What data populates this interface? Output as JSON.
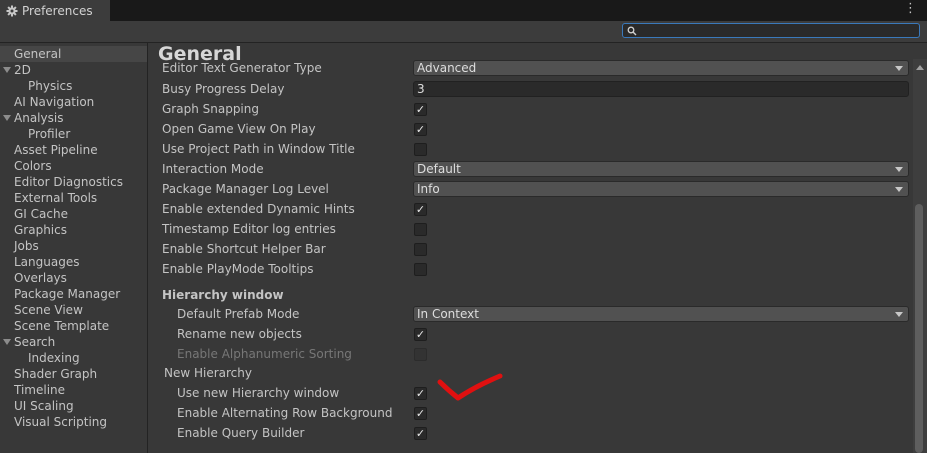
{
  "window": {
    "tab_label": "Preferences",
    "tab_icon": "gear-icon",
    "menu_icon": "kebab-menu-icon",
    "kebab_glyph": "⋮"
  },
  "search": {
    "placeholder": "",
    "value": ""
  },
  "sidebar": {
    "items": [
      {
        "label": "General",
        "selected": true,
        "expandable": false,
        "indent": 1
      },
      {
        "label": "2D",
        "selected": false,
        "expandable": true,
        "indent": 1
      },
      {
        "label": "Physics",
        "selected": false,
        "expandable": false,
        "indent": 2
      },
      {
        "label": "AI Navigation",
        "selected": false,
        "expandable": false,
        "indent": 1
      },
      {
        "label": "Analysis",
        "selected": false,
        "expandable": true,
        "indent": 1
      },
      {
        "label": "Profiler",
        "selected": false,
        "expandable": false,
        "indent": 2
      },
      {
        "label": "Asset Pipeline",
        "selected": false,
        "expandable": false,
        "indent": 1
      },
      {
        "label": "Colors",
        "selected": false,
        "expandable": false,
        "indent": 1
      },
      {
        "label": "Editor Diagnostics",
        "selected": false,
        "expandable": false,
        "indent": 1
      },
      {
        "label": "External Tools",
        "selected": false,
        "expandable": false,
        "indent": 1
      },
      {
        "label": "GI Cache",
        "selected": false,
        "expandable": false,
        "indent": 1
      },
      {
        "label": "Graphics",
        "selected": false,
        "expandable": false,
        "indent": 1
      },
      {
        "label": "Jobs",
        "selected": false,
        "expandable": false,
        "indent": 1
      },
      {
        "label": "Languages",
        "selected": false,
        "expandable": false,
        "indent": 1
      },
      {
        "label": "Overlays",
        "selected": false,
        "expandable": false,
        "indent": 1
      },
      {
        "label": "Package Manager",
        "selected": false,
        "expandable": false,
        "indent": 1
      },
      {
        "label": "Scene View",
        "selected": false,
        "expandable": false,
        "indent": 1
      },
      {
        "label": "Scene Template",
        "selected": false,
        "expandable": false,
        "indent": 1
      },
      {
        "label": "Search",
        "selected": false,
        "expandable": true,
        "indent": 1
      },
      {
        "label": "Indexing",
        "selected": false,
        "expandable": false,
        "indent": 2
      },
      {
        "label": "Shader Graph",
        "selected": false,
        "expandable": false,
        "indent": 1
      },
      {
        "label": "Timeline",
        "selected": false,
        "expandable": false,
        "indent": 1
      },
      {
        "label": "UI Scaling",
        "selected": false,
        "expandable": false,
        "indent": 1
      },
      {
        "label": "Visual Scripting",
        "selected": false,
        "expandable": false,
        "indent": 1
      }
    ]
  },
  "main": {
    "title": "General",
    "rows": [
      {
        "label": "Editor Text Generator Type",
        "control": "dropdown",
        "value": "Advanced",
        "indent": 0,
        "disabled": false,
        "clipped": true
      },
      {
        "label": "Busy Progress Delay",
        "control": "text",
        "value": "3",
        "indent": 0,
        "disabled": false
      },
      {
        "label": "Graph Snapping",
        "control": "checkbox",
        "checked": true,
        "indent": 0,
        "disabled": false
      },
      {
        "label": "Open Game View On Play",
        "control": "checkbox",
        "checked": true,
        "indent": 0,
        "disabled": false
      },
      {
        "label": "Use Project Path in Window Title",
        "control": "checkbox",
        "checked": false,
        "indent": 0,
        "disabled": false
      },
      {
        "label": "Interaction Mode",
        "control": "dropdown",
        "value": "Default",
        "indent": 0,
        "disabled": false
      },
      {
        "label": "Package Manager Log Level",
        "control": "dropdown",
        "value": "Info",
        "indent": 0,
        "disabled": false
      },
      {
        "label": "Enable extended Dynamic Hints",
        "control": "checkbox",
        "checked": true,
        "indent": 0,
        "disabled": false
      },
      {
        "label": "Timestamp Editor log entries",
        "control": "checkbox",
        "checked": false,
        "indent": 0,
        "disabled": false
      },
      {
        "label": "Enable Shortcut Helper Bar",
        "control": "checkbox",
        "checked": false,
        "indent": 0,
        "disabled": false
      },
      {
        "label": "Enable PlayMode Tooltips",
        "control": "checkbox",
        "checked": false,
        "indent": 0,
        "disabled": false
      },
      {
        "label": "Hierarchy window",
        "control": "section",
        "bold": true,
        "indent": 0
      },
      {
        "label": "Default Prefab Mode",
        "control": "dropdown",
        "value": "In Context",
        "indent": 1,
        "disabled": false
      },
      {
        "label": "Rename new objects",
        "control": "checkbox",
        "checked": true,
        "indent": 1,
        "disabled": false
      },
      {
        "label": "Enable Alphanumeric Sorting",
        "control": "checkbox",
        "checked": false,
        "indent": 1,
        "disabled": true
      },
      {
        "label": "New Hierarchy",
        "control": "section",
        "bold": false,
        "indent": 0
      },
      {
        "label": "Use new Hierarchy window",
        "control": "checkbox",
        "checked": true,
        "indent": 1,
        "disabled": false
      },
      {
        "label": "Enable Alternating Row Background",
        "control": "checkbox",
        "checked": true,
        "indent": 1,
        "disabled": false
      },
      {
        "label": "Enable Query Builder",
        "control": "checkbox",
        "checked": true,
        "indent": 1,
        "disabled": false
      }
    ],
    "checkmark_glyph": "✓",
    "annotation": {
      "type": "hand-drawn-checkmark",
      "color": "#e01010"
    }
  },
  "colors": {
    "accent": "#3a79bb",
    "selected_item": "#464646",
    "annotation_red": "#e01010"
  }
}
